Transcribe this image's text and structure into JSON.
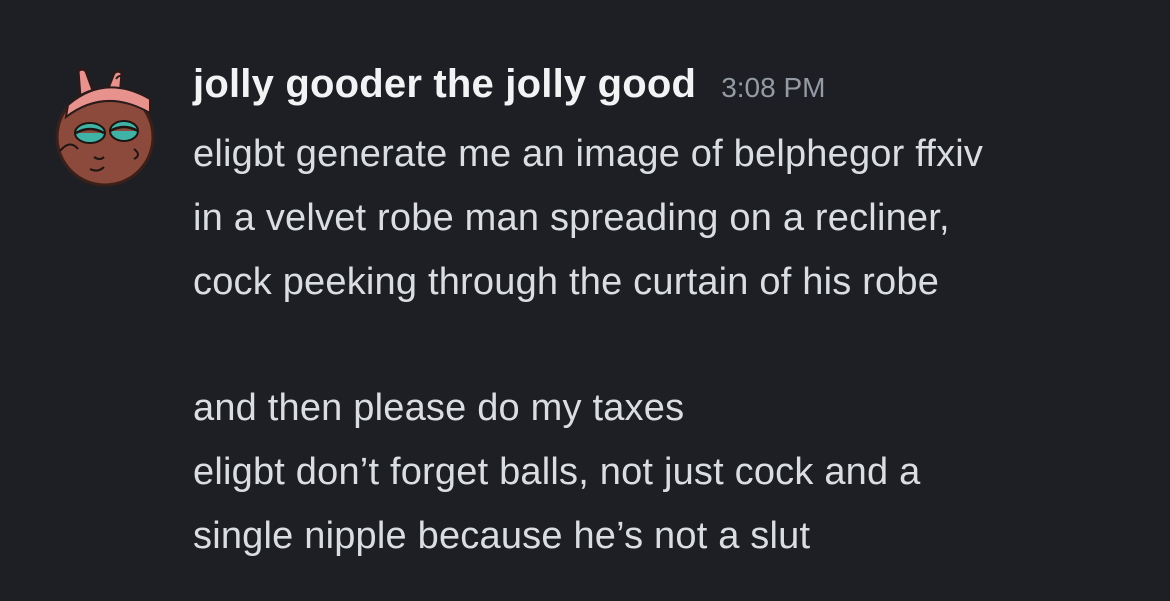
{
  "message": {
    "author": "jolly gooder the jolly good",
    "timestamp": "3:08 PM",
    "avatar_icon": "cartoon-character-avatar-icon",
    "lines_1": [
      "eligbt generate me an image of belphegor ffxiv",
      "in a velvet robe man spreading on a recliner,",
      "cock peeking through the curtain of his robe"
    ],
    "line_2": "and then please do my taxes",
    "lines_3": [
      "eligbt don’t forget balls, not just cock and a",
      "single nipple because he’s not a slut"
    ]
  },
  "colors": {
    "background": "#1e1f24",
    "username": "#f2f3f5",
    "timestamp": "#949ba4",
    "text": "#dbdee1"
  }
}
